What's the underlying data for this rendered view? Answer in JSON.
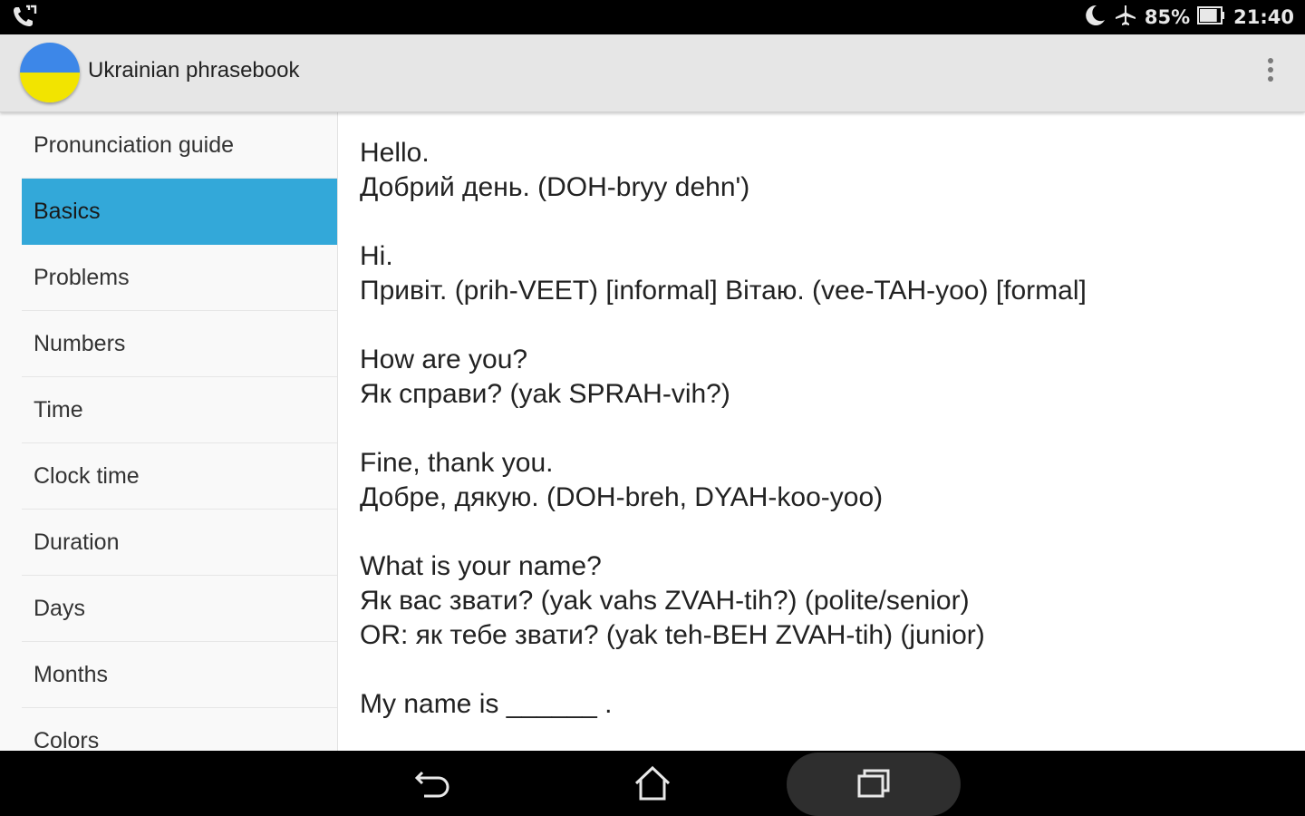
{
  "status_bar": {
    "left_icon": "phone-signal-icon",
    "right_icons": [
      "moon-icon",
      "airplane-icon"
    ],
    "battery_percent": "85%",
    "battery_level": 0.85,
    "time": "21:40"
  },
  "action_bar": {
    "logo_icon": "ukraine-flag-logo",
    "title": "Ukrainian phrasebook",
    "menu_icon": "overflow-menu-icon",
    "colors": {
      "flag_blue": "#3d87e8",
      "flag_yellow": "#f2e400"
    }
  },
  "sidebar": {
    "active_color": "#33a8d9",
    "items": [
      {
        "label": "Pronunciation guide",
        "active": false
      },
      {
        "label": "Basics",
        "active": true
      },
      {
        "label": "Problems",
        "active": false
      },
      {
        "label": "Numbers",
        "active": false
      },
      {
        "label": "Time",
        "active": false
      },
      {
        "label": "Clock time",
        "active": false
      },
      {
        "label": "Duration",
        "active": false
      },
      {
        "label": "Days",
        "active": false
      },
      {
        "label": "Months",
        "active": false
      },
      {
        "label": "Colors",
        "active": false
      }
    ]
  },
  "phrases": [
    {
      "english": "Hello.",
      "lines": [
        "Добрий день. (DOH-bryy dehn')"
      ]
    },
    {
      "english": "Hi.",
      "lines": [
        "Привіт. (prih-VEET) [informal] Вітаю. (vee-TAH-yoo) [formal]"
      ]
    },
    {
      "english": "How are you?",
      "lines": [
        "Як справи? (yak SPRAH-vih?)"
      ]
    },
    {
      "english": "Fine, thank you.",
      "lines": [
        "Добре, дякую. (DOH-breh, DYAH-koo-yoo)"
      ]
    },
    {
      "english": "What is your name?",
      "lines": [
        "Як вас звати? (yak vahs ZVAH-tih?) (polite/senior)",
        "OR: як тебе звати? (yak teh-BEH ZVAH-tih) (junior)"
      ]
    },
    {
      "english": "My name is ______ .",
      "lines": []
    }
  ],
  "nav_bar": {
    "back_icon": "back-icon",
    "home_icon": "home-icon",
    "recents_icon": "recent-apps-icon"
  }
}
